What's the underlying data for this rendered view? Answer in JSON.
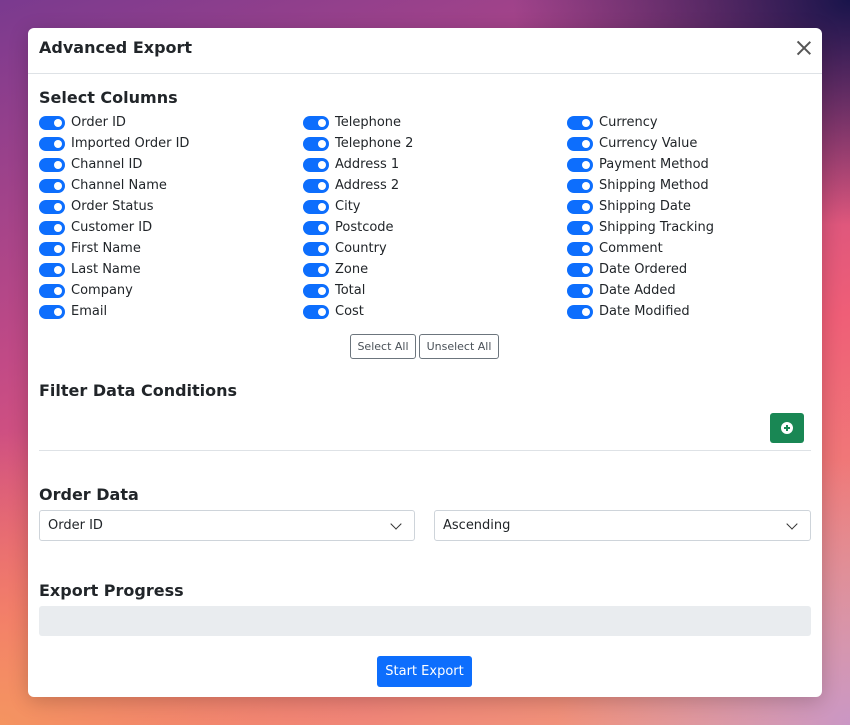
{
  "modal": {
    "title": "Advanced Export",
    "close_icon": "close-icon"
  },
  "columns": {
    "title": "Select Columns",
    "col1": [
      "Order ID",
      "Imported Order ID",
      "Channel ID",
      "Channel Name",
      "Order Status",
      "Customer ID",
      "First Name",
      "Last Name",
      "Company",
      "Email"
    ],
    "col2": [
      "Telephone",
      "Telephone 2",
      "Address 1",
      "Address 2",
      "City",
      "Postcode",
      "Country",
      "Zone",
      "Total",
      "Cost"
    ],
    "col3": [
      "Currency",
      "Currency Value",
      "Payment Method",
      "Shipping Method",
      "Shipping Date",
      "Shipping Tracking",
      "Comment",
      "Date Ordered",
      "Date Added",
      "Date Modified"
    ],
    "select_all": "Select All",
    "unselect_all": "Unselect All"
  },
  "filter": {
    "title": "Filter Data Conditions",
    "add_icon": "plus-circle-icon"
  },
  "order": {
    "title": "Order Data",
    "field_value": "Order ID",
    "direction_value": "Ascending"
  },
  "progress": {
    "title": "Export Progress",
    "value": 0
  },
  "actions": {
    "start_export": "Start Export"
  },
  "colors": {
    "primary": "#0d6efd",
    "success": "#198754"
  }
}
